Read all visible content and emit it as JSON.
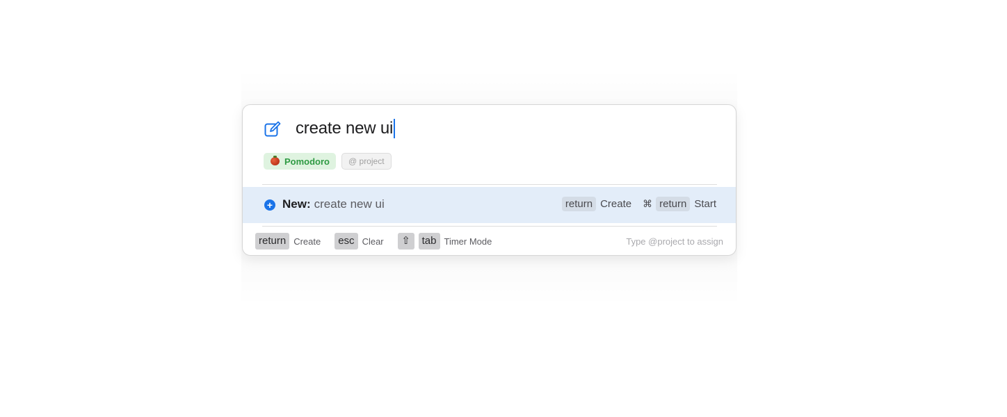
{
  "composer": {
    "icon": "compose-icon",
    "title_value": "create new ui",
    "mode_chip": {
      "icon": "tomato-icon",
      "label": "Pomodoro"
    },
    "project_chip": {
      "label": "@ project"
    }
  },
  "suggestion": {
    "icon": "plus-circle-icon",
    "prefix": "New:",
    "value": "create new ui",
    "actions": [
      {
        "key": "return",
        "label": "Create"
      },
      {
        "modifier": "⌘",
        "key": "return",
        "label": "Start"
      }
    ]
  },
  "footer": {
    "shortcuts": [
      {
        "key": "return",
        "label": "Create"
      },
      {
        "key": "esc",
        "label": "Clear"
      },
      {
        "modifier": "⇧",
        "key": "tab",
        "label": "Timer Mode"
      }
    ],
    "hint": "Type @project to assign"
  },
  "colors": {
    "accent": "#1a73e8",
    "highlight": "#e3edf9",
    "mode_chip_bg": "#dff3e0",
    "mode_chip_text": "#2e9a43"
  }
}
